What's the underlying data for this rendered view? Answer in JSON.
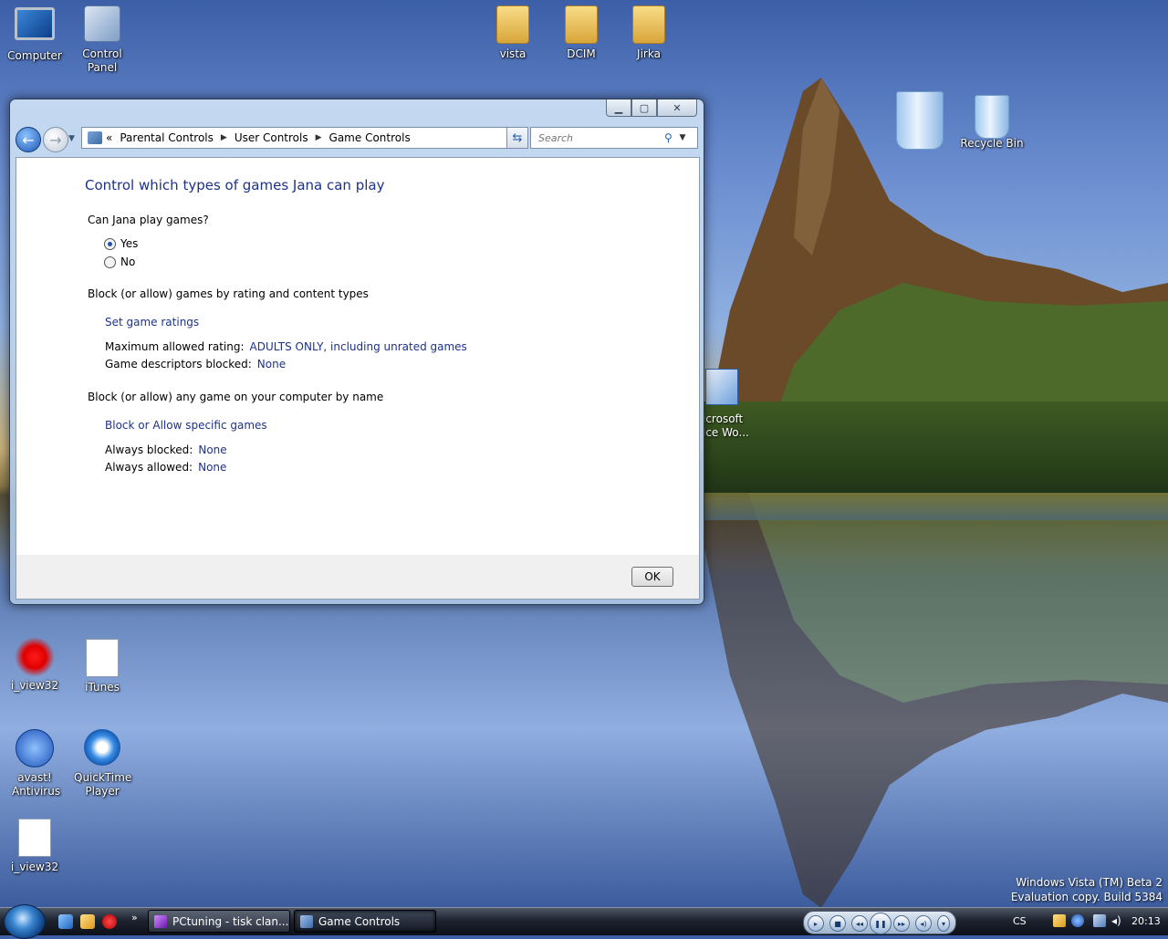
{
  "desktop": {
    "icons": {
      "computer": "Computer",
      "control_panel": "Control Panel",
      "vista": "vista",
      "dcim": "DCIM",
      "jirka": "Jirka",
      "recycle_bin": "Recycle Bin",
      "i_view32_a": "i_view32",
      "itunes": "iTunes",
      "avast": "avast! Antivirus",
      "quicktime": "QuickTime Player",
      "i_view32_b": "i_view32",
      "office_word_partial": "icrosoft\nice Wo..."
    },
    "watermark_line1": "Windows Vista (TM) Beta 2",
    "watermark_line2": "Evaluation copy. Build 5384"
  },
  "window": {
    "breadcrumb": [
      "Parental Controls",
      "User Controls",
      "Game Controls"
    ],
    "breadcrumb_prefix": "«",
    "search_placeholder": "Search",
    "heading": "Control which types of games Jana can play",
    "question": "Can Jana play games?",
    "radio_yes": "Yes",
    "radio_no": "No",
    "selected": "Yes",
    "section1_title": "Block (or allow) games by rating and content types",
    "link_set_ratings": "Set game ratings",
    "max_rating_label": "Maximum allowed rating:",
    "max_rating_value": "ADULTS ONLY, including unrated games",
    "descriptors_label": "Game descriptors blocked:",
    "descriptors_value": "None",
    "section2_title": "Block (or allow) any game on your computer by name",
    "link_block_allow": "Block or Allow specific games",
    "always_blocked_label": "Always blocked:",
    "always_blocked_value": "None",
    "always_allowed_label": "Always allowed:",
    "always_allowed_value": "None",
    "ok_label": "OK"
  },
  "taskbar": {
    "tasks": [
      {
        "label": "PCtuning - tisk clan...",
        "active": false
      },
      {
        "label": "Game Controls",
        "active": true
      }
    ],
    "language": "CS",
    "clock": "20:13",
    "overflow_chevron": "»"
  },
  "colors": {
    "link_blue": "#1e3287",
    "taskbar_dark": "#0b0f18"
  }
}
